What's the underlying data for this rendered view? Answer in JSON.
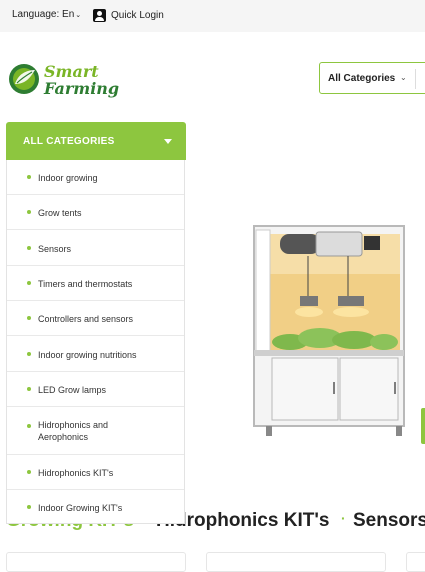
{
  "topbar": {
    "language_label": "Language: En",
    "quick_login_label": "Quick Login"
  },
  "logo": {
    "line1": "Smart",
    "line2": "Farming"
  },
  "category_select": {
    "label": "All Categories"
  },
  "categories_menu": {
    "header": "ALL CATEGORIES",
    "items": [
      "Indoor growing",
      "Grow tents",
      "Sensors",
      "Timers and thermostats",
      "Controllers and sensors",
      "Indoor growing nutritions",
      "LED Grow lamps",
      "Hidrophonics and Aerophonics",
      "Hidrophonics KIT's",
      "Indoor Growing KIT's"
    ]
  },
  "product_tabs": [
    "Growing KIT's",
    "Hidrophonics KIT's",
    "Sensors"
  ],
  "colors": {
    "accent": "#8dc63f",
    "dark_green": "#2e7d32"
  }
}
